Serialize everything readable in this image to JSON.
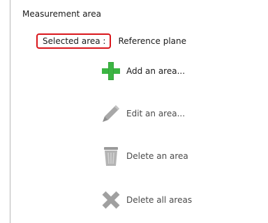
{
  "panel": {
    "title": "Measurement area",
    "selected_label": "Selected area :",
    "selected_value": "Reference plane"
  },
  "actions": [
    {
      "label": "Add an area...",
      "icon": "plus-icon",
      "enabled": true
    },
    {
      "label": "Edit an area...",
      "icon": "pencil-icon",
      "enabled": false
    },
    {
      "label": "Delete an area",
      "icon": "trash-icon",
      "enabled": false
    },
    {
      "label": "Delete all areas",
      "icon": "x-icon",
      "enabled": false
    }
  ],
  "colors": {
    "highlight_border": "#d9151b",
    "add_icon": "#3cb543",
    "disabled_icon": "#a8a8a8"
  }
}
